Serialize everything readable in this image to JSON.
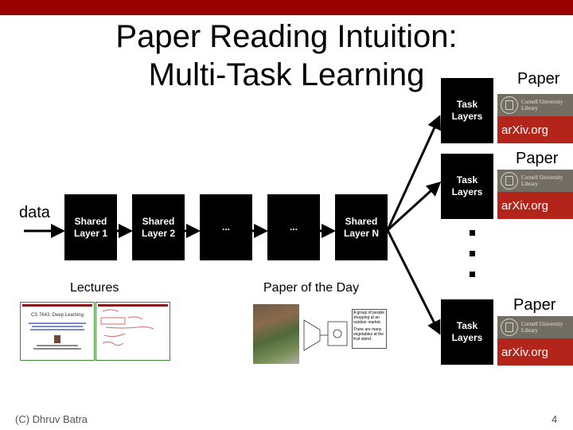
{
  "slide": {
    "title_line1": "Paper Reading Intuition:",
    "title_line2": "Multi-Task Learning",
    "accent_color": "#990000"
  },
  "diagram": {
    "input_label": "data",
    "shared_layers": [
      {
        "line1": "Shared",
        "line2": "Layer 1"
      },
      {
        "line1": "Shared",
        "line2": "Layer 2"
      },
      {
        "line1": "...",
        "line2": ""
      },
      {
        "line1": "...",
        "line2": ""
      },
      {
        "line1": "Shared",
        "line2": "Layer N"
      }
    ],
    "task_layers": [
      {
        "line1": "Task",
        "line2": "Layers",
        "output_label": "Paper"
      },
      {
        "line1": "Task",
        "line2": "Layers",
        "output_label": "Paper"
      },
      {
        "line1": "Task",
        "line2": "Layers",
        "output_label": "Paper"
      }
    ],
    "arxiv_logo": {
      "institution_line1": "Cornell University",
      "institution_line2": "Library",
      "site": "arXiv.org"
    }
  },
  "sections": {
    "lectures_label": "Lectures",
    "lecture_thumb_title": "CS 7643: Deep Learning",
    "paper_of_day_label": "Paper of the Day",
    "paper_caption_1": "A group of people shopping at an outdoor market.",
    "paper_caption_2": "There are many vegetables at the fruit stand."
  },
  "footer": {
    "credit": "(C) Dhruv Batra",
    "page_number": "4"
  }
}
